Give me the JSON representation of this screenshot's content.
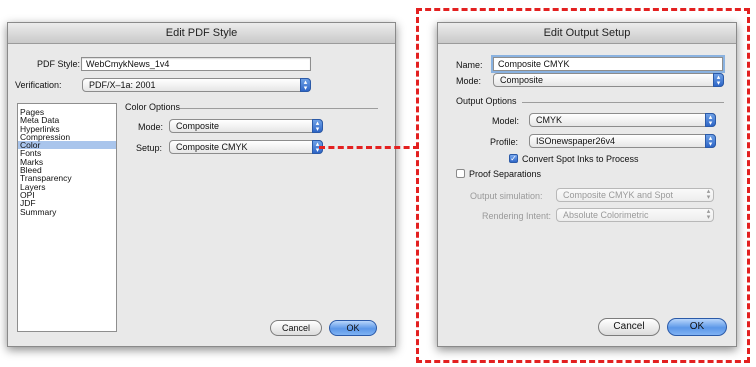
{
  "pdf_dialog": {
    "title": "Edit PDF Style",
    "pdf_style_label": "PDF Style:",
    "pdf_style_value": "WebCmykNews_1v4",
    "verification_label": "Verification:",
    "verification_value": "PDF/X–1a: 2001",
    "categories": [
      "Pages",
      "Meta Data",
      "Hyperlinks",
      "Compression",
      "Color",
      "Fonts",
      "Marks",
      "Bleed",
      "Transparency",
      "Layers",
      "OPI",
      "JDF",
      "Summary"
    ],
    "selected_category": "Color",
    "color_options_label": "Color Options",
    "mode_label": "Mode:",
    "mode_value": "Composite",
    "setup_label": "Setup:",
    "setup_value": "Composite CMYK",
    "cancel_label": "Cancel",
    "ok_label": "OK"
  },
  "output_dialog": {
    "title": "Edit Output Setup",
    "name_label": "Name:",
    "name_value": "Composite CMYK",
    "mode_label": "Mode:",
    "mode_value": "Composite",
    "output_options_label": "Output Options",
    "model_label": "Model:",
    "model_value": "CMYK",
    "profile_label": "Profile:",
    "profile_value": "ISOnewspaper26v4",
    "convert_spot_label": "Convert Spot Inks to Process",
    "convert_spot_checked": true,
    "proof_separations_label": "Proof Separations",
    "proof_separations_checked": false,
    "output_sim_label": "Output simulation:",
    "output_sim_value": "Composite CMYK and Spot",
    "rendering_intent_label": "Rendering Intent:",
    "rendering_intent_value": "Absolute Colorimetric",
    "cancel_label": "Cancel",
    "ok_label": "OK"
  },
  "colors": {
    "highlight": "#e32020",
    "selection": "#a9c5ec",
    "accent": "#2e66c7"
  }
}
